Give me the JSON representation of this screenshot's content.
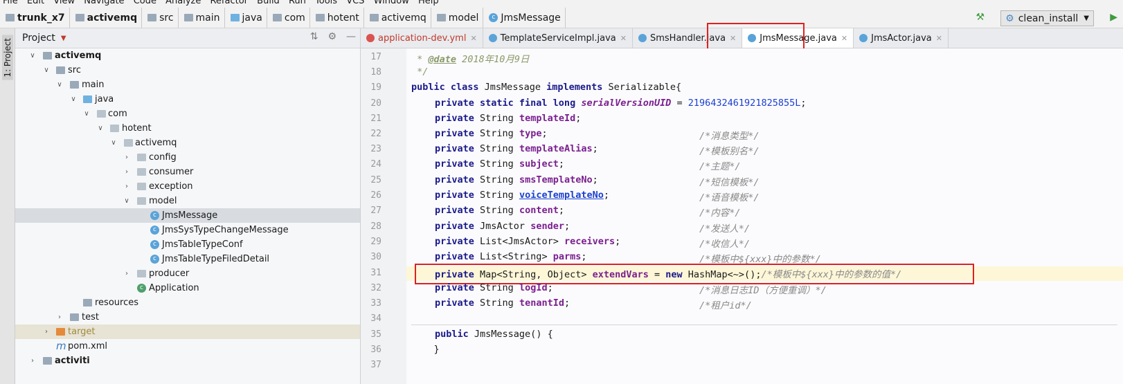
{
  "menu": [
    "File",
    "Edit",
    "View",
    "Navigate",
    "Code",
    "Analyze",
    "Refactor",
    "Build",
    "Run",
    "Tools",
    "VCS",
    "Window",
    "Help"
  ],
  "breadcrumb": [
    "trunk_x7",
    "activemq",
    "src",
    "main",
    "java",
    "com",
    "hotent",
    "activemq",
    "model",
    "JmsMessage"
  ],
  "run_config": "clean_install",
  "side_tab": "1: Project",
  "project_panel": {
    "title": "Project"
  },
  "tree": [
    {
      "label": "activemq",
      "bold": true
    },
    {
      "label": "src"
    },
    {
      "label": "main"
    },
    {
      "label": "java"
    },
    {
      "label": "com"
    },
    {
      "label": "hotent"
    },
    {
      "label": "activemq"
    },
    {
      "label": "config"
    },
    {
      "label": "consumer"
    },
    {
      "label": "exception"
    },
    {
      "label": "model"
    },
    {
      "label": "JmsMessage"
    },
    {
      "label": "JmsSysTypeChangeMessage"
    },
    {
      "label": "JmsTableTypeConf"
    },
    {
      "label": "JmsTableTypeFiledDetail"
    },
    {
      "label": "producer"
    },
    {
      "label": "Application"
    },
    {
      "label": "resources"
    },
    {
      "label": "test"
    },
    {
      "label": "target"
    },
    {
      "label": "pom.xml"
    },
    {
      "label": "activiti",
      "bold": true
    }
  ],
  "tabs": [
    "application-dev.yml",
    "TemplateServiceImpl.java",
    "SmsHandler.java",
    "JmsMessage.java",
    "JmsActor.java"
  ],
  "active_tab": "JmsMessage.java",
  "line_numbers": [
    "17",
    "18",
    "19",
    "20",
    "21",
    "22",
    "23",
    "24",
    "25",
    "26",
    "27",
    "28",
    "29",
    "30",
    "31",
    "32",
    "33",
    "34",
    "35",
    "36",
    "37"
  ],
  "code": {
    "l17_star": " * ",
    "l17_tag": "@date",
    "l17_rest": " 2018年10月9日",
    "l18": " */",
    "l19_kw1": "public class",
    "l19_name": " JmsMessage ",
    "l19_kw2": "implements",
    "l19_rest": " Serializable{",
    "l20_kw": "private static final long",
    "l20_var": "serialVersionUID",
    "l20_eq": " = ",
    "l20_num": "2196432461921825855L",
    "l20_end": ";",
    "kw_private": "private",
    "t_string": " String ",
    "f_templateId": "templateId",
    "f_type": "type",
    "f_templateAlias": "templateAlias",
    "f_subject": "subject",
    "f_smsTemplateNo": "smsTemplateNo",
    "f_voiceTemplateNo": "voiceTemplateNo",
    "f_content": "content",
    "t_jmsactor": " JmsActor ",
    "f_sender": "sender",
    "t_listactor": " List<JmsActor> ",
    "f_receivers": "receivers",
    "t_liststring": " List<String> ",
    "f_parms": "parms",
    "t_map": " Map<String, Object> ",
    "f_extendVars": "extendVars",
    "l31_eq": " = ",
    "l31_new": "new",
    "l31_rest": " HashMap<~>();",
    "f_logId": "logId",
    "f_tenantId": "tenantId",
    "semi": ";",
    "c_type": "/*消息类型*/",
    "c_alias": "/*模板别名*/",
    "c_subject": "/*主题*/",
    "c_sms": "/*短信模板*/",
    "c_voice": "/*语音模板*/",
    "c_content": "/*内容*/",
    "c_sender": "/*发送人*/",
    "c_receivers": "/*收信人*/",
    "c_parms": "/*模板中${xxx}中的参数*/",
    "c_extend": "/*模板中${xxx}中的参数的值*/",
    "c_logid": "/*消息日志ID（方便重调）*/",
    "c_tenant": "/*租户id*/",
    "l35_kw": "public",
    "l35_rest": " JmsMessage() {",
    "l36": "    }"
  }
}
